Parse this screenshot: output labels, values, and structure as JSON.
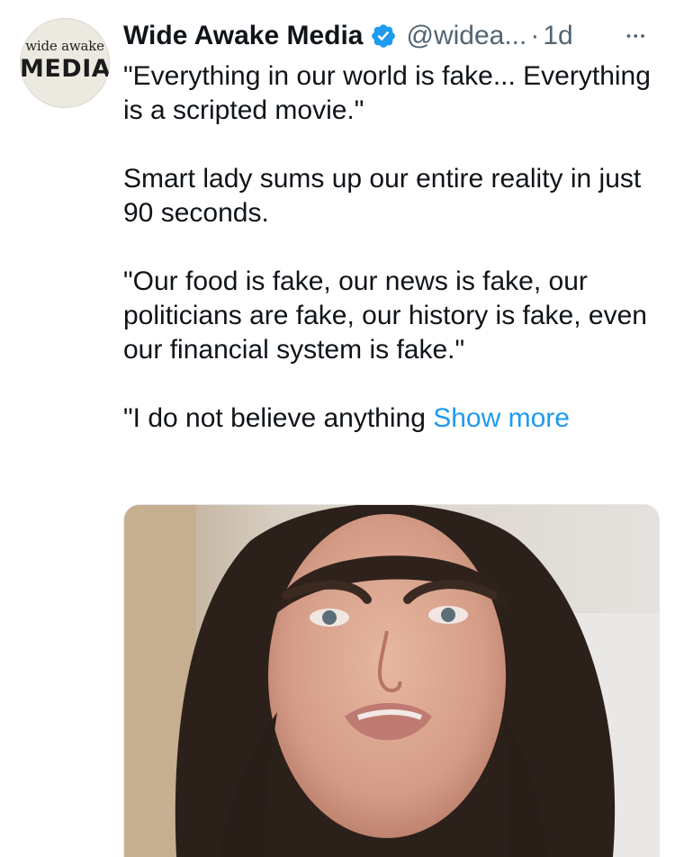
{
  "avatar": {
    "logo_line1": "wide awake",
    "logo_line2": "MEDIA"
  },
  "header": {
    "author_name": "Wide Awake Media",
    "handle": "@widea...",
    "separator": "·",
    "time": "1d",
    "verified_icon": "verified-badge-icon",
    "more_icon": "more-horizontal-icon"
  },
  "tweet": {
    "paragraphs": [
      "\"Everything in our world is fake... Everything is a scripted movie.\"",
      "Smart lady sums up our entire reality in just 90 seconds.",
      "\"Our food is fake, our news is fake, our politicians are fake, our history is fake, even our financial system is fake.\""
    ],
    "last_paragraph": "\"I do not believe anything ",
    "show_more": "Show more"
  },
  "colors": {
    "text": "#0f1419",
    "secondary": "#536471",
    "link": "#1d9bf0",
    "verified": "#1d9bf0"
  }
}
